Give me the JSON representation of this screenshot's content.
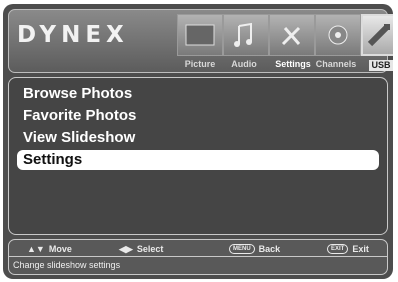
{
  "brand": "DYNEX",
  "tabs": [
    {
      "label": "Picture",
      "selected": false
    },
    {
      "label": "Audio",
      "selected": false
    },
    {
      "label": "Settings",
      "selected": false
    },
    {
      "label": "Channels",
      "selected": false
    },
    {
      "label": "USB",
      "selected": true
    }
  ],
  "menu": {
    "items": [
      {
        "label": "Browse Photos",
        "selected": false
      },
      {
        "label": "Favorite Photos",
        "selected": false
      },
      {
        "label": "View Slideshow",
        "selected": false
      },
      {
        "label": "Settings",
        "selected": true
      }
    ]
  },
  "footer": {
    "move_keys": "▲▼",
    "move_label": "Move",
    "select_keys": "◀▶",
    "select_label": "Select",
    "menu_key": "MENU",
    "back_label": "Back",
    "exit_key": "EXIT",
    "exit_label": "Exit",
    "status": "Change slideshow settings"
  },
  "colors": {
    "background": "#4d4d4d",
    "selected_item": "#ffffff"
  }
}
